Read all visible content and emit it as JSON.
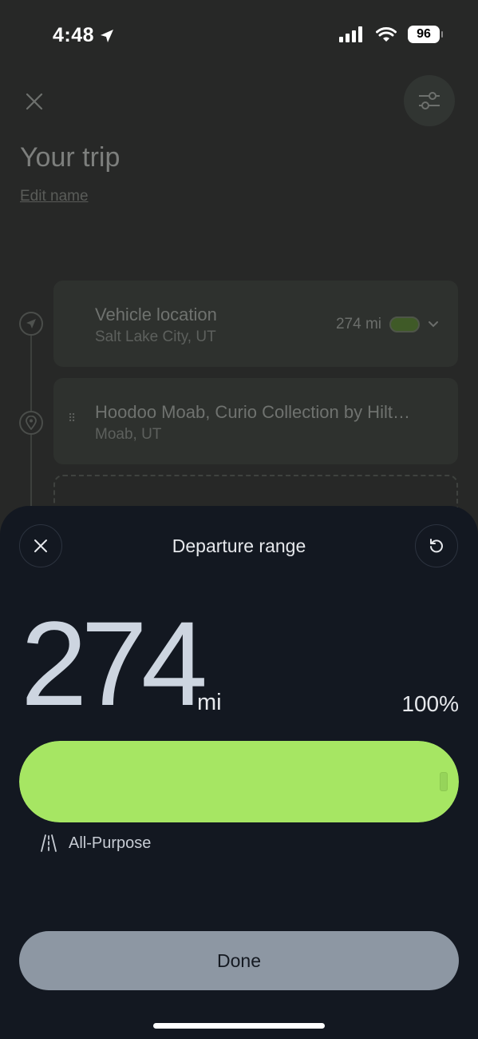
{
  "status": {
    "time": "4:48",
    "battery": "96"
  },
  "trip": {
    "title": "Your trip",
    "edit_name": "Edit name",
    "stops": [
      {
        "title": "Vehicle location",
        "subtitle": "Salt Lake City, UT",
        "range": "274 mi"
      },
      {
        "title": "Hoodoo Moab, Curio Collection by Hilt…",
        "subtitle": "Moab, UT"
      }
    ]
  },
  "sheet": {
    "title": "Departure range",
    "range_value": "274",
    "range_unit": "mi",
    "range_percent": "100%",
    "range_fraction": 1.0,
    "mode_label": "All-Purpose",
    "done_label": "Done"
  },
  "colors": {
    "accent_green": "#a6e663",
    "sheet_bg": "#131821",
    "done_button": "#8d97a3"
  }
}
